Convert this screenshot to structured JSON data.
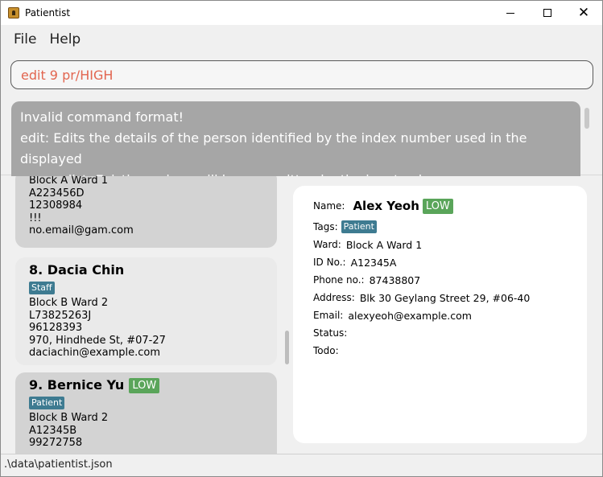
{
  "window": {
    "title": "Patientist"
  },
  "menu": {
    "file": "File",
    "help": "Help"
  },
  "command": {
    "value": "edit 9 pr/HIGH"
  },
  "result": {
    "line1": "Invalid command format!",
    "line2": "edit: Edits the details of the person identified by the index number used in the displayed",
    "line3": "person list. Existing values will be overwritten by the input values."
  },
  "list": {
    "card_a": {
      "line1": "Block A Ward 1",
      "line2": "A223456D",
      "line3": "12308984",
      "line4": "!!!",
      "line5": "no.email@gam.com"
    },
    "card_b": {
      "index_name": "8.  Dacia Chin",
      "tag": "Staff",
      "ward": "Block B Ward 2",
      "id": "L73825263J",
      "phone": "96128393",
      "address": "970, Hindhede St, #07-27",
      "email": "daciachin@example.com"
    },
    "card_c": {
      "index_name": "9.  Bernice Yu",
      "priority": "LOW",
      "tag": "Patient",
      "ward": "Block B Ward 2",
      "id": "A12345B",
      "phone": "99272758"
    }
  },
  "detail": {
    "name_label": "Name:",
    "name": "Alex Yeoh",
    "priority": "LOW",
    "tags_label": "Tags:",
    "tag": "Patient",
    "ward_label": "Ward:",
    "ward": "Block A Ward 1",
    "id_label": "ID No.:",
    "id": "A12345A",
    "phone_label": "Phone no.:",
    "phone": "87438807",
    "address_label": "Address:",
    "address": "Blk 30 Geylang Street 29, #06-40",
    "email_label": "Email:",
    "email": "alexyeoh@example.com",
    "status_label": "Status:",
    "todo_label": "Todo:"
  },
  "statusbar": {
    "path": ".\\data\\patientist.json"
  },
  "colors": {
    "tag": "#3e7b91",
    "priority_low": "#5aa55a",
    "command_text": "#e2654f",
    "result_bg": "#a6a6a6"
  }
}
